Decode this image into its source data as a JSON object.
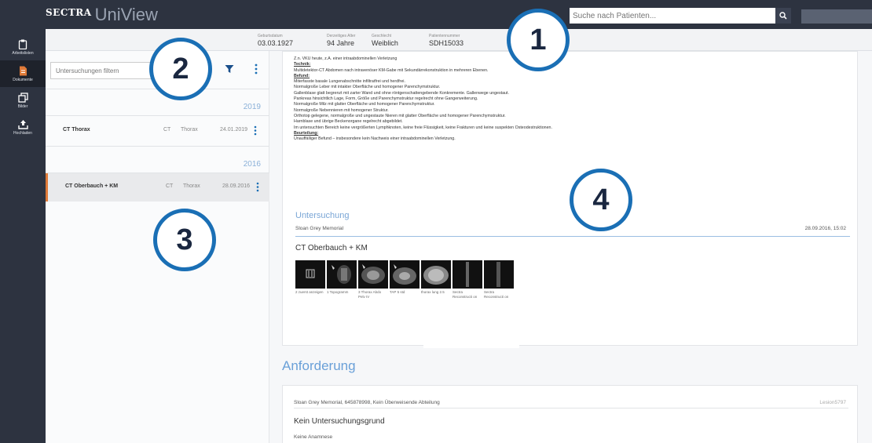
{
  "app": {
    "brand": "SECTRA",
    "product": "UniView"
  },
  "search": {
    "placeholder": "Suche nach Patienten..."
  },
  "nav": [
    {
      "label": "Arbeitslisten",
      "icon": "clipboard-icon"
    },
    {
      "label": "Dokumente",
      "icon": "document-icon"
    },
    {
      "label": "Bilder",
      "icon": "images-icon"
    },
    {
      "label": "Hochladen",
      "icon": "upload-icon"
    }
  ],
  "patient": {
    "birth_label": "Geburtsdatum",
    "birth": "03.03.1927",
    "age_label": "Derzeitiges Alter",
    "age": "94 Jahre",
    "sex_label": "Geschlecht",
    "sex": "Weiblich",
    "id_label": "Patientennummer",
    "id": "SDH15033"
  },
  "filter": {
    "placeholder": "Untersuchungen filtern"
  },
  "exams": {
    "year1": "2019",
    "year2": "2016",
    "row1": {
      "name": "CT Thorax",
      "modality": "CT",
      "body": "Thorax",
      "date": "24.01.2019"
    },
    "row2": {
      "name": "CT Oberbauch + KM",
      "modality": "CT",
      "body": "Thorax",
      "date": "28.09.2016"
    }
  },
  "report": {
    "l1": "Z.n. VKU heute, z.A. einer intraabdominellen Verletzung",
    "technik_h": "Technik:",
    "l2": "Multidetektor-CT Abdomen nach intravenöser KM-Gabe mit Sekundärrekonstruktion in mehreren Ebenen.",
    "befund_h": "Befund:",
    "l3": "Miterfasste basale Lungenabschnitte infiltratfrei und herdfrei.",
    "l4": "Normalgroße Leber mit intakter Oberfläche und homogener Parenchymstruktur.",
    "l5": "Gallenblase glatt begrenzt mit zarter Wand und ohne röntgenschattengebende Konkremente. Gallenwege ungestaut.",
    "l6": "Pankreas hinsichtlich Lage, Form, Größe und Parenchymstruktur regelrecht ohne Gangerweiterung.",
    "l7": "Normalgroße Milz mit glatter Oberfläche und homogener Parenchymstruktur.",
    "l8": "Normalgroße Nebennieren mit homogener Struktur.",
    "l9": "Orthotop gelegene, normalgroße und ungestaute Nieren mit glatter Oberfläche und homogener Parenchymstruktur.",
    "l10": "Harnblase und übrige Beckenorgane regelrecht abgebildet.",
    "l11": "Im untersuchten Bereich keine vergrößerten Lymphknoten, keine freie Flüssigkeit, keine Frakturen und keine suspekten Osteodestruktionen.",
    "beurt_h": "Beurteilung:",
    "l12": "Unauffälliger Befund – insbesondere kein Nachweis einer intraabdominellen Verletzung."
  },
  "untersuchung": {
    "title": "Untersuchung",
    "hospital": "Sloan Grey Memorial",
    "datetime": "28.09.2016, 15:02",
    "exam_title": "CT Oberbauch + KM",
    "thumbs": [
      {
        "caption": "2 zuerst anzeigen"
      },
      {
        "caption": "1 Topogramm"
      },
      {
        "caption": "3 Thorax Abdo Pelv IV"
      },
      {
        "caption": "TAP 5 std"
      },
      {
        "caption": "thorax lung 2.5"
      },
      {
        "caption": "Sectra Reconstructi on"
      },
      {
        "caption": "Sectra Reconstructi on"
      }
    ]
  },
  "anforderung": {
    "title": "Anforderung",
    "meta": "Sloan Grey Memorial, 645878998, Kein Überweisende Abteilung",
    "id": "Lesion5797",
    "headline": "Kein Untersuchungsgrund",
    "sub": "Keine Anamnese"
  },
  "callouts": [
    "1",
    "2",
    "3",
    "4"
  ]
}
